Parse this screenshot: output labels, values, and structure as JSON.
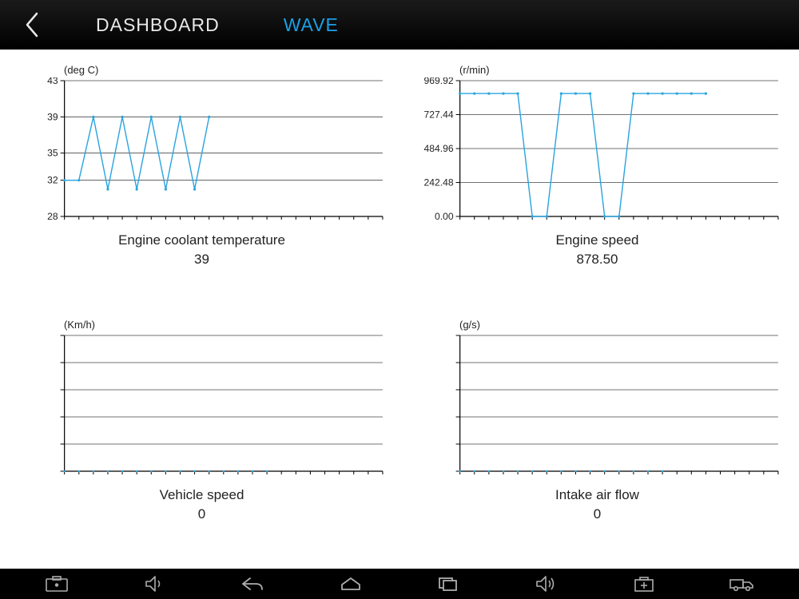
{
  "header": {
    "tabs": [
      {
        "label": "DASHBOARD",
        "active": false
      },
      {
        "label": "WAVE",
        "active": true
      }
    ]
  },
  "chart_data": [
    {
      "type": "line",
      "unit_label": "(deg C)",
      "title": "Engine coolant temperature",
      "current_value": "39",
      "ylim": [
        28,
        43
      ],
      "yticks": [
        28,
        32,
        35,
        39,
        43
      ],
      "x": [
        0,
        1,
        2,
        3,
        4,
        5,
        6,
        7,
        8,
        9,
        10
      ],
      "values": [
        32,
        32,
        39,
        31,
        39,
        31,
        39,
        31,
        39,
        31,
        39
      ],
      "xlabel": "",
      "ylabel": ""
    },
    {
      "type": "line",
      "unit_label": "(r/min)",
      "title": "Engine speed",
      "current_value": "878.50",
      "ylim": [
        0,
        969.92
      ],
      "yticks": [
        0.0,
        242.48,
        484.96,
        727.44,
        969.92
      ],
      "x": [
        0,
        1,
        2,
        3,
        4,
        5,
        6,
        7,
        8,
        9,
        10,
        11,
        12,
        13,
        14,
        15,
        16,
        17
      ],
      "values": [
        878,
        878,
        878,
        878,
        878,
        0,
        0,
        878,
        878,
        878,
        0,
        0,
        878,
        878,
        878,
        878,
        878,
        878
      ],
      "xlabel": "",
      "ylabel": ""
    },
    {
      "type": "line",
      "unit_label": "(Km/h)",
      "title": "Vehicle speed",
      "current_value": "0",
      "ylim": [
        0,
        5
      ],
      "yticks": [
        0,
        1,
        2,
        3,
        4,
        5
      ],
      "x": [
        0,
        1,
        2,
        3,
        4,
        5,
        6,
        7,
        8,
        9,
        10,
        11,
        12,
        13,
        14
      ],
      "values": [
        0,
        0,
        0,
        0,
        0,
        0,
        0,
        0,
        0,
        0,
        0,
        0,
        0,
        0,
        0
      ],
      "show_ytick_labels": false,
      "xlabel": "",
      "ylabel": ""
    },
    {
      "type": "line",
      "unit_label": "(g/s)",
      "title": "Intake air flow",
      "current_value": "0",
      "ylim": [
        0,
        5
      ],
      "yticks": [
        0,
        1,
        2,
        3,
        4,
        5
      ],
      "x": [
        0,
        1,
        2,
        3,
        4,
        5,
        6,
        7,
        8,
        9,
        10,
        11,
        12,
        13,
        14
      ],
      "values": [
        0,
        0,
        0,
        0,
        0,
        0,
        0,
        0,
        0,
        0,
        0,
        0,
        0,
        0,
        0
      ],
      "show_ytick_labels": false,
      "xlabel": "",
      "ylabel": ""
    }
  ]
}
